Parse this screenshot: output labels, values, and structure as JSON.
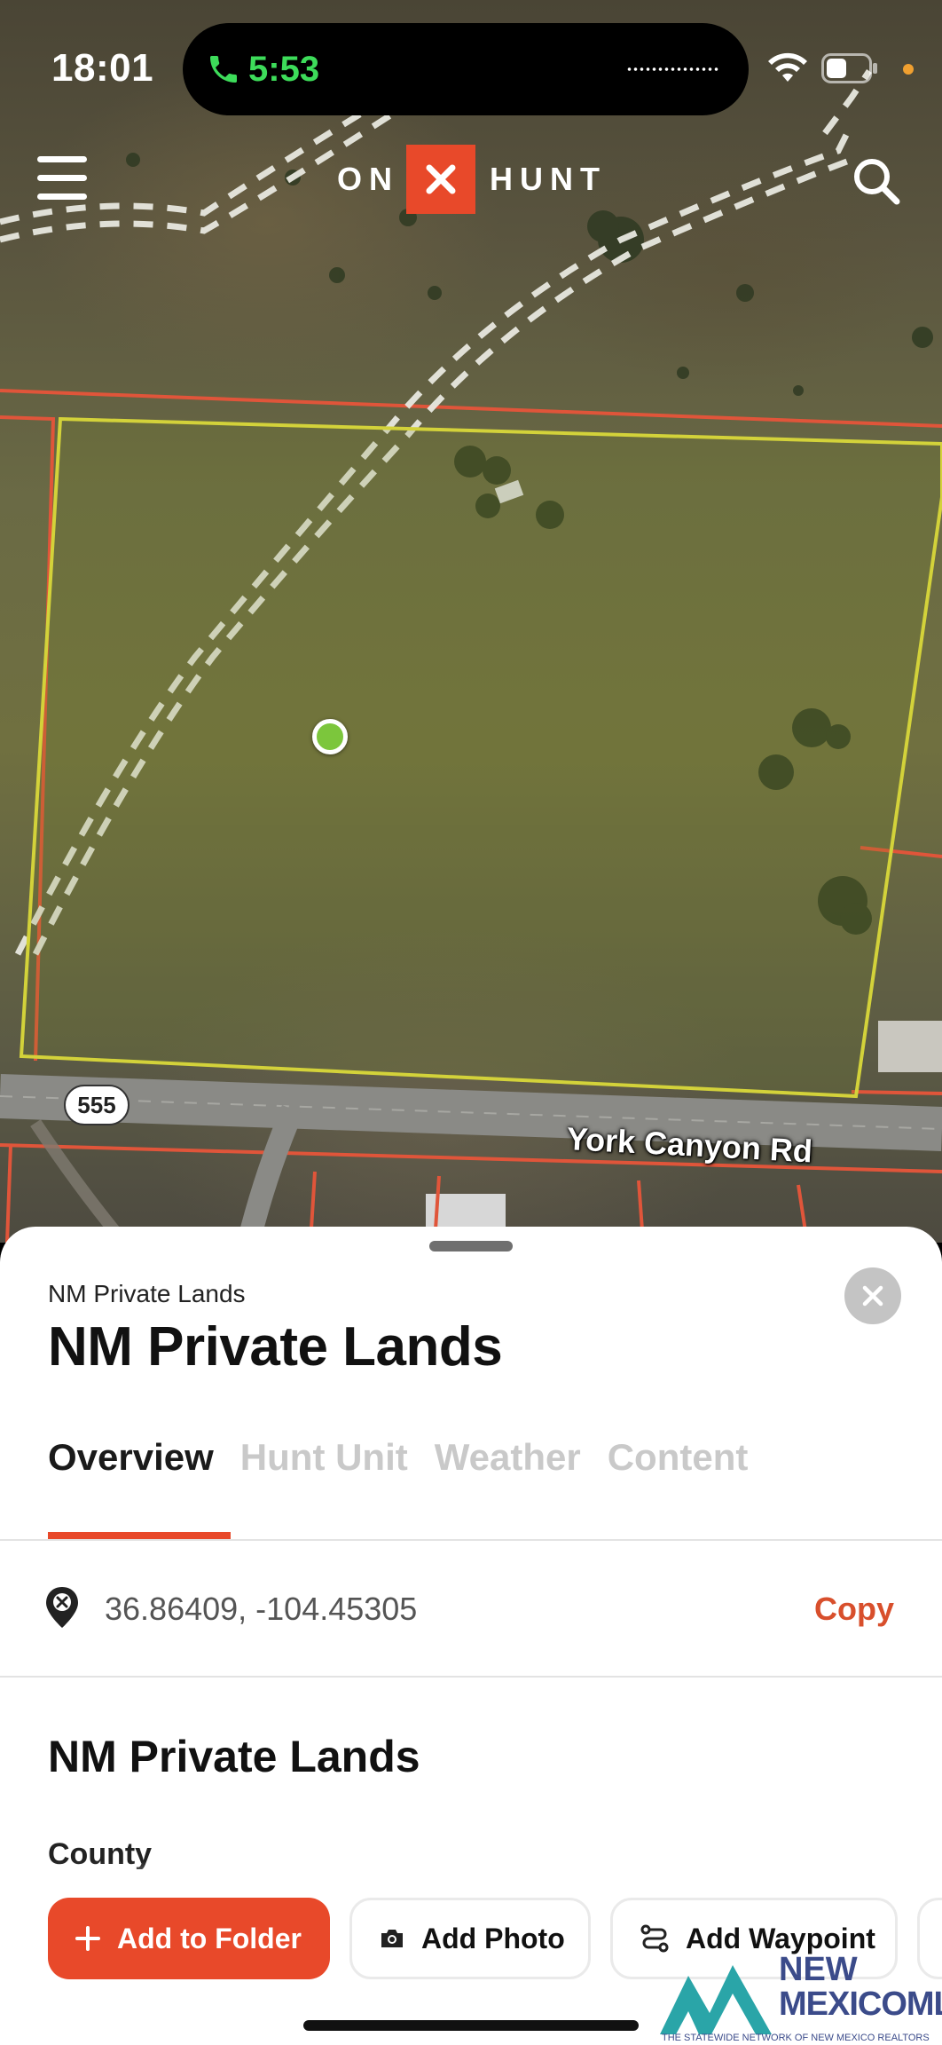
{
  "status_bar": {
    "time": "18:01",
    "call_time": "5:53",
    "call_color": "#3ddc5a"
  },
  "map": {
    "logo": {
      "left": "ON",
      "right": "HUNT",
      "accent": "#e8492a"
    },
    "road_shield": "555",
    "road_name": "York Canyon Rd",
    "icons": [
      "menu-icon",
      "search-icon",
      "phone-icon",
      "wifi-icon",
      "battery-icon"
    ]
  },
  "sheet": {
    "subtitle": "NM Private Lands",
    "title": "NM Private Lands",
    "tabs": [
      {
        "label": "Overview",
        "active": true
      },
      {
        "label": "Hunt Unit",
        "active": false
      },
      {
        "label": "Weather",
        "active": false
      },
      {
        "label": "Content",
        "active": false
      }
    ],
    "coordinates": "36.86409, -104.45305",
    "copy_label": "Copy",
    "section_title": "NM Private Lands",
    "field_label": "County",
    "actions": {
      "add_to_folder": "Add to Folder",
      "add_photo": "Add Photo",
      "add_waypoint": "Add Waypoint"
    }
  },
  "watermark": {
    "line1": "NEW",
    "line2": "MEXICOMLS",
    "tagline": "THE STATEWIDE NETWORK OF NEW MEXICO REALTORS"
  },
  "colors": {
    "accent": "#e8492a",
    "copy": "#d84f2c",
    "parcel_boundary": "#d3d23a",
    "other_parcels": "#e0553a"
  }
}
